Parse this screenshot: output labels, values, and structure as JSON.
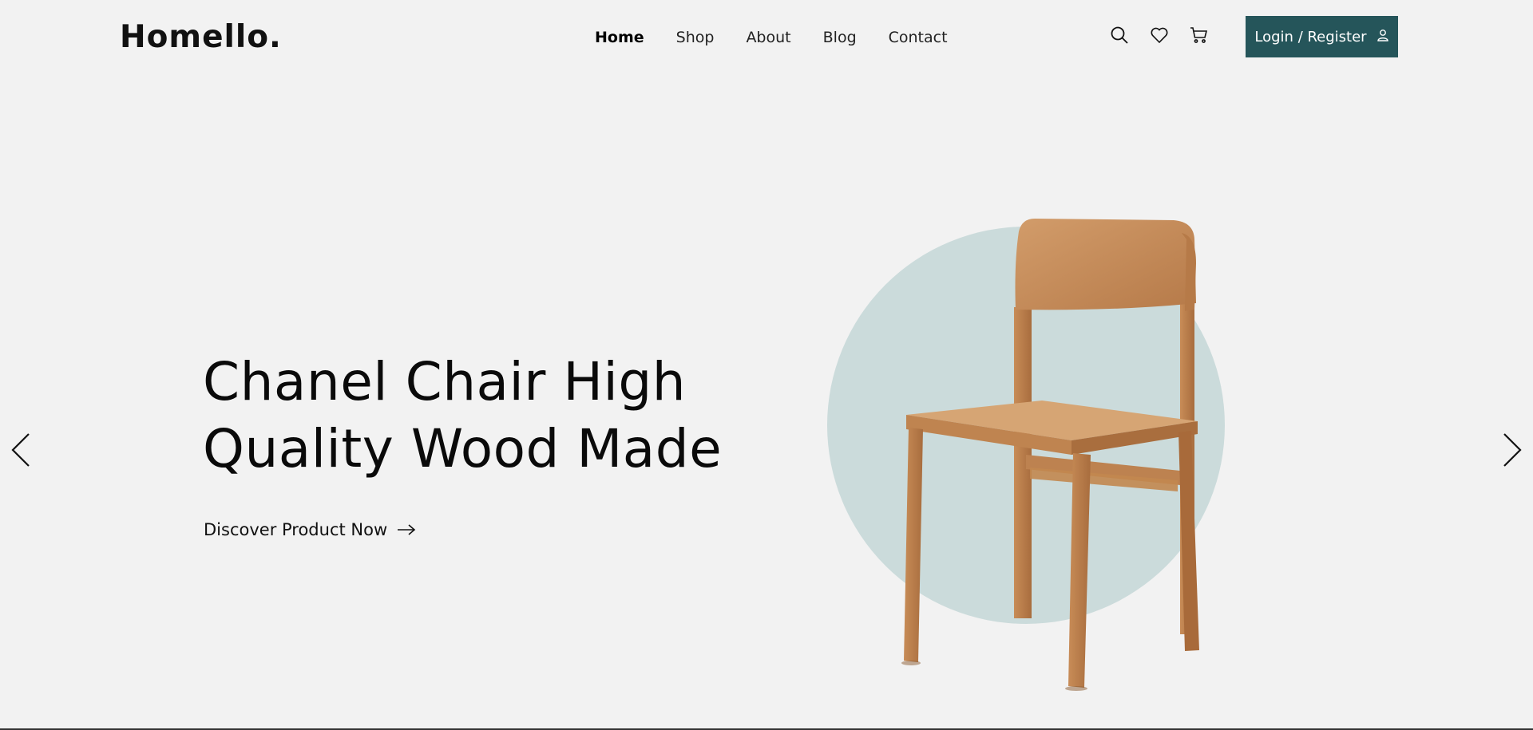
{
  "brand": {
    "logo": "Homello."
  },
  "nav": {
    "items": [
      {
        "label": "Home",
        "active": true
      },
      {
        "label": "Shop"
      },
      {
        "label": "About"
      },
      {
        "label": "Blog"
      },
      {
        "label": "Contact"
      }
    ]
  },
  "header_icons": [
    "search-icon",
    "heart-icon",
    "cart-icon"
  ],
  "login": {
    "label": "Login / Register",
    "icon": "user-icon"
  },
  "hero": {
    "title_line1": "Chanel Chair High",
    "title_line2": "Quality Wood Made",
    "cta_label": "Discover Product Now",
    "cta_icon": "arrow-right-icon",
    "image": "wooden-chair"
  },
  "slider": {
    "prev_icon": "chevron-left-icon",
    "next_icon": "chevron-right-icon"
  },
  "colors": {
    "background": "#f2f2f2",
    "accent": "#25555a",
    "circle": "#cbdbdb",
    "wood": "#c68a58"
  }
}
